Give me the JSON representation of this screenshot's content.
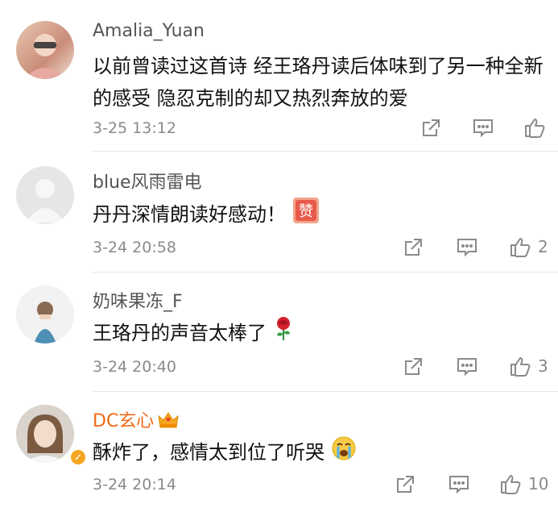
{
  "comments": [
    {
      "username": "Amalia_Yuan",
      "text": "以前曾读过这首诗 经王珞丹读后体味到了另一种全新的感受 隐忍克制的却又热烈奔放的爱",
      "time": "3-25 13:12",
      "likes": ""
    },
    {
      "username": "blue风雨雷电",
      "text": "丹丹深情朗读好感动！",
      "sticker": "赞",
      "time": "3-24 20:58",
      "likes": "2"
    },
    {
      "username": "奶味果冻_F",
      "text": "王珞丹的声音太棒了",
      "time": "3-24 20:40",
      "likes": "3"
    },
    {
      "username": "DC玄心",
      "text": "酥炸了，感情太到位了听哭",
      "time": "3-24 20:14",
      "likes": "10"
    }
  ],
  "colors": {
    "vip_username": "#ef6a17",
    "username": "#555555",
    "meta": "#8a8a8a",
    "badge": "#f5a623"
  },
  "icons": [
    "share-icon",
    "comment-icon",
    "like-icon",
    "rose-emoji",
    "crying-emoji",
    "crown-icon",
    "zan-sticker"
  ]
}
